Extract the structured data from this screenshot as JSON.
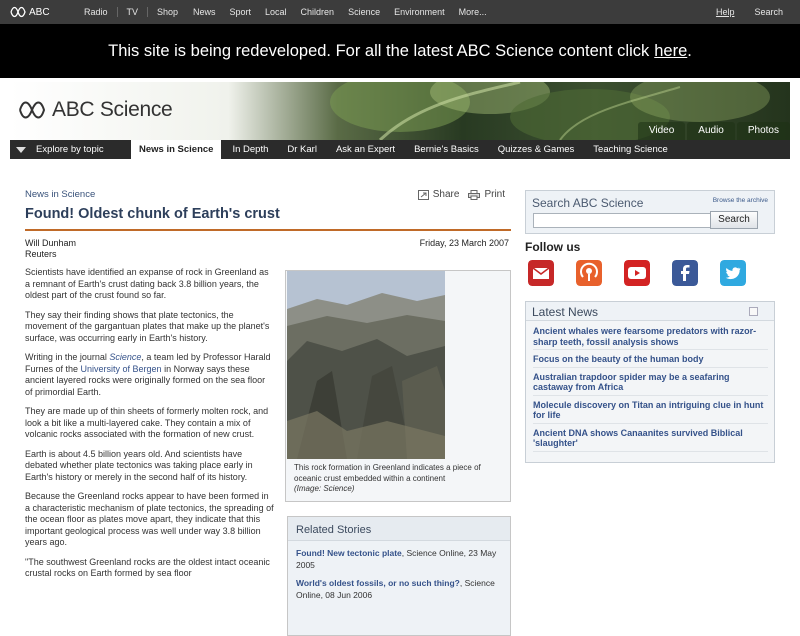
{
  "global_nav": {
    "logo_text": "ABC",
    "left_links": [
      "Radio",
      "TV",
      "Shop"
    ],
    "mid_links": [
      "News",
      "Sport",
      "Local",
      "Children",
      "Science",
      "Environment",
      "More..."
    ],
    "help": "Help",
    "search": "Search"
  },
  "banner": {
    "text": "This site is being redeveloped. For all the latest ABC Science content click",
    "link": "here",
    "tail": "."
  },
  "header": {
    "brand": "ABC Science",
    "media_tabs": [
      "Video",
      "Audio",
      "Photos"
    ]
  },
  "section_nav": {
    "explore": "Explore by topic",
    "tabs": [
      "News in Science",
      "In Depth",
      "Dr Karl",
      "Ask an Expert",
      "Bernie's Basics",
      "Quizzes & Games",
      "Teaching Science"
    ]
  },
  "article": {
    "breadcrumb": "News in Science",
    "share": "Share",
    "print": "Print",
    "headline": "Found! Oldest chunk of Earth's crust",
    "author": "Will Dunham",
    "agency": "Reuters",
    "date": "Friday, 23 March 2007",
    "p1": "Scientists have identified an expanse of rock in Greenland as a remnant of Earth's crust dating back 3.8 billion years, the oldest part of the crust found so far.",
    "p2": "They say their finding shows that plate tectonics, the movement of the gargantuan plates that make up the planet's surface, was occurring early in Earth's history.",
    "p3_a": "Writing in the journal ",
    "p3_link1": "Science",
    "p3_b": ", a team led by Professor Harald Furnes of the ",
    "p3_link2": "University of Bergen",
    "p3_c": " in Norway says these ancient layered rocks were originally formed on the sea floor of primordial Earth.",
    "p4": "They are made up of thin sheets of formerly molten rock, and look a bit like a multi-layered cake. They contain a mix of volcanic rocks associated with the formation of new crust.",
    "p5": "Earth is about 4.5 billion years old. And scientists have debated whether plate tectonics was taking place early in Earth's history or merely in the second half of its history.",
    "p6": "Because the Greenland rocks appear to have been formed in a characteristic mechanism of plate tectonics, the spreading of the ocean floor as plates move apart, they indicate that this important geological process was well under way 3.8 billion years ago.",
    "p7": "\"The southwest Greenland rocks are the oldest intact oceanic crustal rocks on Earth formed by sea floor"
  },
  "photo": {
    "caption": "This rock formation in Greenland indicates a piece of oceanic crust embedded within a continent",
    "credit": "(Image: Science)"
  },
  "related": {
    "title": "Related Stories",
    "items": [
      {
        "title": "Found! New tectonic plate",
        "meta": ", Science Online, 23 May 2005"
      },
      {
        "title": "World's oldest fossils, or no such thing?",
        "meta": ", Science Online, 08 Jun 2006"
      }
    ]
  },
  "sidebar": {
    "search_title": "Search ABC Science",
    "browse": "Browse the archive",
    "search_button": "Search",
    "follow": "Follow us",
    "latest_title": "Latest News",
    "latest": [
      "Ancient whales were fearsome predators with razor-sharp teeth, fossil analysis shows",
      "Focus on the beauty of the human body",
      "Australian trapdoor spider may be a seafaring castaway from Africa",
      "Molecule discovery on Titan an intriguing clue in hunt for life",
      "Ancient DNA shows Canaanites survived Biblical 'slaughter'"
    ]
  },
  "colors": {
    "accent_rule": "#c06a28",
    "link": "#35528a"
  }
}
